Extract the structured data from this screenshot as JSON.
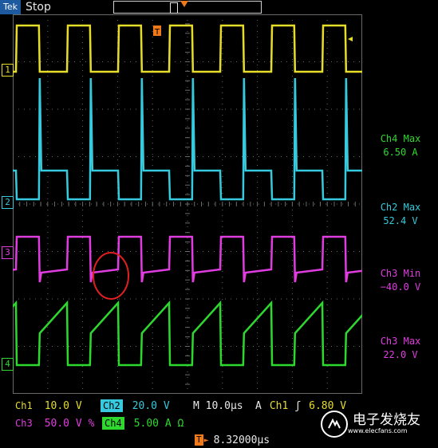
{
  "header": {
    "brand": "Tek",
    "status": "Stop"
  },
  "colors": {
    "ch1": "#e6dd2a",
    "ch2": "#37c9dd",
    "ch3": "#e03de0",
    "ch4": "#2ed82e",
    "grid": "#6a6a6a",
    "annotation": "#e02020"
  },
  "channel_markers": [
    "1",
    "2",
    "3",
    "4"
  ],
  "measurements": [
    {
      "label": "Ch4 Max",
      "value": "6.50 A",
      "color": "#2ed82e"
    },
    {
      "label": "Ch2 Max",
      "value": "52.4 V",
      "color": "#37c9dd"
    },
    {
      "label": "Ch3 Min",
      "value": "−40.0 V",
      "color": "#e03de0"
    },
    {
      "label": "Ch3 Max",
      "value": "22.0 V",
      "color": "#e03de0"
    }
  ],
  "settings": {
    "ch1_label": "Ch1",
    "ch1_scale": "10.0 V",
    "ch2_label": "Ch2",
    "ch2_scale": "20.0 V",
    "timebase": "M 10.0µs",
    "trigger_mode": "A",
    "trigger_source": "Ch1",
    "trigger_slope": "ʃ",
    "trigger_level": "6.80 V",
    "ch3_label": "Ch3",
    "ch3_scale": "50.0 V",
    "ch3_bw": "%",
    "ch4_label": "Ch4",
    "ch4_scale": "5.00 A Ω",
    "trigger_position": "8.32000µs"
  },
  "watermark": {
    "logo_text": "elecfans",
    "title": "电子发烧友",
    "subtitle": "www.elecfans.com"
  }
}
